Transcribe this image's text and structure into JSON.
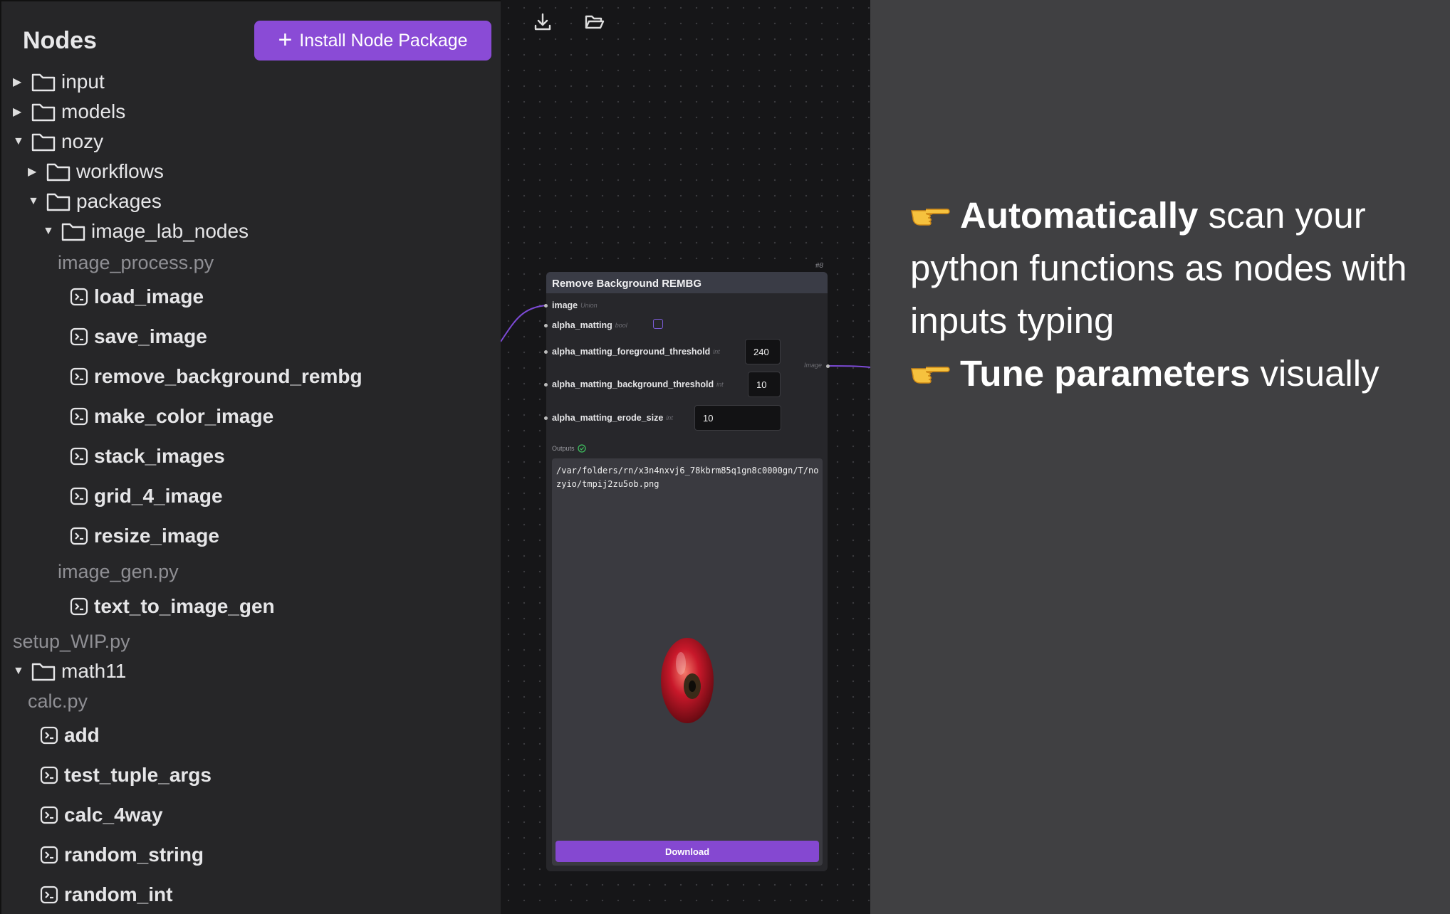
{
  "sidebar": {
    "title": "Nodes",
    "install_button": "Install Node Package",
    "tree": {
      "input": "input",
      "models": "models",
      "nozy": "nozy",
      "workflows": "workflows",
      "packages": "packages",
      "image_lab_nodes": "image_lab_nodes",
      "image_process_file": "image_process.py",
      "load_image": "load_image",
      "save_image": "save_image",
      "remove_background_rembg": "remove_background_rembg",
      "make_color_image": "make_color_image",
      "stack_images": "stack_images",
      "grid_4_image": "grid_4_image",
      "resize_image": "resize_image",
      "image_gen_file": "image_gen.py",
      "text_to_image_gen": "text_to_image_gen",
      "setup_file": "setup_WIP.py",
      "math11": "math11",
      "calc_file": "calc.py",
      "add": "add",
      "test_tuple_args": "test_tuple_args",
      "calc_4way": "calc_4way",
      "random_string": "random_string",
      "random_int": "random_int"
    }
  },
  "canvas": {
    "node": {
      "id": "#8",
      "title": "Remove Background REMBG",
      "params": {
        "image": {
          "label": "image",
          "type": "Union"
        },
        "alpha_matting": {
          "label": "alpha_matting",
          "type": "bool",
          "checked": false
        },
        "fg_threshold": {
          "label": "alpha_matting_foreground_threshold",
          "type": "int",
          "value": "240"
        },
        "bg_threshold": {
          "label": "alpha_matting_background_threshold",
          "type": "int",
          "value": "10"
        },
        "erode_size": {
          "label": "alpha_matting_erode_size",
          "type": "int",
          "value": "10"
        }
      },
      "output_label": "Image",
      "outputs_title": "Outputs",
      "output_path": "/var/folders/rn/x3n4nxvj6_78kbrm85q1gn8c0000gn/T/nozyio/tmpij2zu5ob.png",
      "download_label": "Download"
    }
  },
  "features": {
    "line1_bold": "Automatically",
    "line1_rest": " scan your",
    "line2": "python functions as nodes with",
    "line3": "inputs typing",
    "line4_bold": "Tune parameters",
    "line4_rest": " visually"
  },
  "colors": {
    "accent": "#8a4bd6",
    "sidebar_bg": "#262628",
    "canvas_bg": "#161618",
    "page_bg": "#404042"
  },
  "icons": [
    "folder-icon",
    "function-icon",
    "caret-icon",
    "download-icon",
    "folder-open-icon",
    "pointing-hand-icon",
    "check-circle-icon"
  ]
}
